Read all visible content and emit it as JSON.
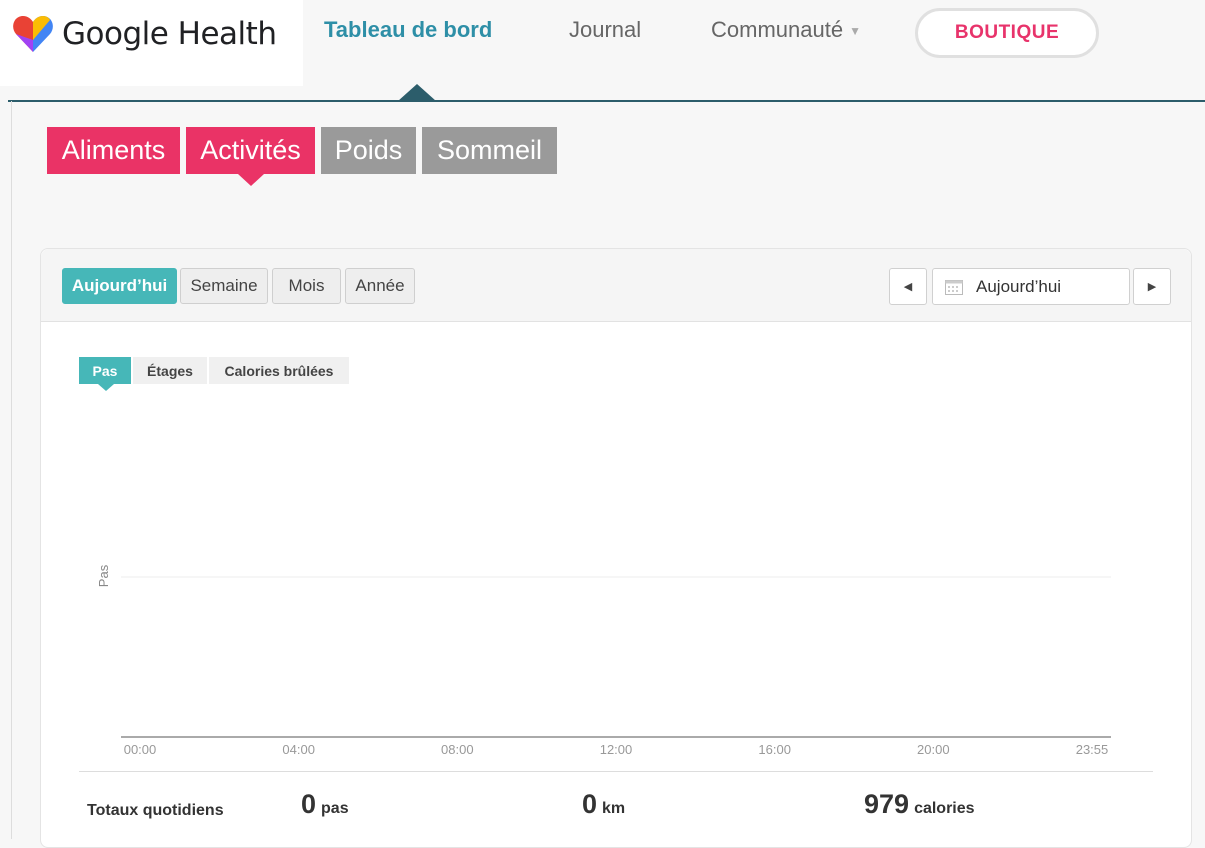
{
  "brand": {
    "name": "Google Health"
  },
  "nav": {
    "items": [
      {
        "label": "Tableau de bord"
      },
      {
        "label": "Journal"
      },
      {
        "label": "Communauté"
      }
    ],
    "shop_label": "BOUTIQUE"
  },
  "categories": [
    {
      "label": "Aliments"
    },
    {
      "label": "Activités"
    },
    {
      "label": "Poids"
    },
    {
      "label": "Sommeil"
    }
  ],
  "periods": [
    {
      "label": "Aujourd’hui"
    },
    {
      "label": "Semaine"
    },
    {
      "label": "Mois"
    },
    {
      "label": "Année"
    }
  ],
  "date_picker": {
    "value": "Aujourd’hui"
  },
  "metrics": [
    {
      "label": "Pas"
    },
    {
      "label": "Étages"
    },
    {
      "label": "Calories brûlées"
    }
  ],
  "chart_data": {
    "type": "bar",
    "ylabel": "Pas",
    "x_ticks": [
      "00:00",
      "04:00",
      "08:00",
      "12:00",
      "16:00",
      "20:00",
      "23:55"
    ],
    "values": [],
    "grid": true
  },
  "totals": {
    "label": "Totaux quotidiens",
    "steps": {
      "value": "0",
      "unit": "pas"
    },
    "distance": {
      "value": "0",
      "unit": "km"
    },
    "calories": {
      "value": "979",
      "unit": "calories"
    }
  },
  "colors": {
    "accent_pink": "#ea3366",
    "accent_teal": "#46b7b8",
    "nav_blue": "#2e8fa7"
  }
}
